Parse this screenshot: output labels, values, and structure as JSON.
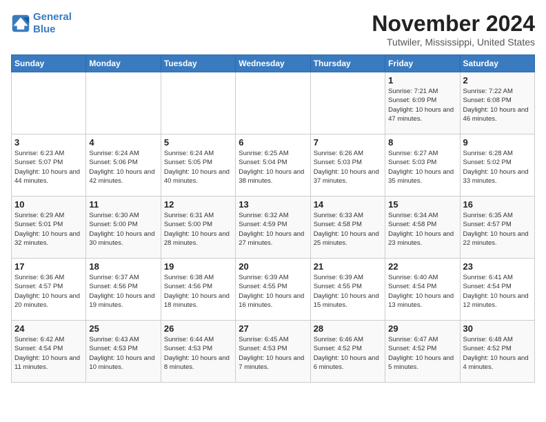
{
  "logo": {
    "line1": "General",
    "line2": "Blue"
  },
  "title": "November 2024",
  "location": "Tutwiler, Mississippi, United States",
  "days_of_week": [
    "Sunday",
    "Monday",
    "Tuesday",
    "Wednesday",
    "Thursday",
    "Friday",
    "Saturday"
  ],
  "weeks": [
    [
      {
        "day": "",
        "info": ""
      },
      {
        "day": "",
        "info": ""
      },
      {
        "day": "",
        "info": ""
      },
      {
        "day": "",
        "info": ""
      },
      {
        "day": "",
        "info": ""
      },
      {
        "day": "1",
        "info": "Sunrise: 7:21 AM\nSunset: 6:09 PM\nDaylight: 10 hours and 47 minutes."
      },
      {
        "day": "2",
        "info": "Sunrise: 7:22 AM\nSunset: 6:08 PM\nDaylight: 10 hours and 46 minutes."
      }
    ],
    [
      {
        "day": "3",
        "info": "Sunrise: 6:23 AM\nSunset: 5:07 PM\nDaylight: 10 hours and 44 minutes."
      },
      {
        "day": "4",
        "info": "Sunrise: 6:24 AM\nSunset: 5:06 PM\nDaylight: 10 hours and 42 minutes."
      },
      {
        "day": "5",
        "info": "Sunrise: 6:24 AM\nSunset: 5:05 PM\nDaylight: 10 hours and 40 minutes."
      },
      {
        "day": "6",
        "info": "Sunrise: 6:25 AM\nSunset: 5:04 PM\nDaylight: 10 hours and 38 minutes."
      },
      {
        "day": "7",
        "info": "Sunrise: 6:26 AM\nSunset: 5:03 PM\nDaylight: 10 hours and 37 minutes."
      },
      {
        "day": "8",
        "info": "Sunrise: 6:27 AM\nSunset: 5:03 PM\nDaylight: 10 hours and 35 minutes."
      },
      {
        "day": "9",
        "info": "Sunrise: 6:28 AM\nSunset: 5:02 PM\nDaylight: 10 hours and 33 minutes."
      }
    ],
    [
      {
        "day": "10",
        "info": "Sunrise: 6:29 AM\nSunset: 5:01 PM\nDaylight: 10 hours and 32 minutes."
      },
      {
        "day": "11",
        "info": "Sunrise: 6:30 AM\nSunset: 5:00 PM\nDaylight: 10 hours and 30 minutes."
      },
      {
        "day": "12",
        "info": "Sunrise: 6:31 AM\nSunset: 5:00 PM\nDaylight: 10 hours and 28 minutes."
      },
      {
        "day": "13",
        "info": "Sunrise: 6:32 AM\nSunset: 4:59 PM\nDaylight: 10 hours and 27 minutes."
      },
      {
        "day": "14",
        "info": "Sunrise: 6:33 AM\nSunset: 4:58 PM\nDaylight: 10 hours and 25 minutes."
      },
      {
        "day": "15",
        "info": "Sunrise: 6:34 AM\nSunset: 4:58 PM\nDaylight: 10 hours and 23 minutes."
      },
      {
        "day": "16",
        "info": "Sunrise: 6:35 AM\nSunset: 4:57 PM\nDaylight: 10 hours and 22 minutes."
      }
    ],
    [
      {
        "day": "17",
        "info": "Sunrise: 6:36 AM\nSunset: 4:57 PM\nDaylight: 10 hours and 20 minutes."
      },
      {
        "day": "18",
        "info": "Sunrise: 6:37 AM\nSunset: 4:56 PM\nDaylight: 10 hours and 19 minutes."
      },
      {
        "day": "19",
        "info": "Sunrise: 6:38 AM\nSunset: 4:56 PM\nDaylight: 10 hours and 18 minutes."
      },
      {
        "day": "20",
        "info": "Sunrise: 6:39 AM\nSunset: 4:55 PM\nDaylight: 10 hours and 16 minutes."
      },
      {
        "day": "21",
        "info": "Sunrise: 6:39 AM\nSunset: 4:55 PM\nDaylight: 10 hours and 15 minutes."
      },
      {
        "day": "22",
        "info": "Sunrise: 6:40 AM\nSunset: 4:54 PM\nDaylight: 10 hours and 13 minutes."
      },
      {
        "day": "23",
        "info": "Sunrise: 6:41 AM\nSunset: 4:54 PM\nDaylight: 10 hours and 12 minutes."
      }
    ],
    [
      {
        "day": "24",
        "info": "Sunrise: 6:42 AM\nSunset: 4:54 PM\nDaylight: 10 hours and 11 minutes."
      },
      {
        "day": "25",
        "info": "Sunrise: 6:43 AM\nSunset: 4:53 PM\nDaylight: 10 hours and 10 minutes."
      },
      {
        "day": "26",
        "info": "Sunrise: 6:44 AM\nSunset: 4:53 PM\nDaylight: 10 hours and 8 minutes."
      },
      {
        "day": "27",
        "info": "Sunrise: 6:45 AM\nSunset: 4:53 PM\nDaylight: 10 hours and 7 minutes."
      },
      {
        "day": "28",
        "info": "Sunrise: 6:46 AM\nSunset: 4:52 PM\nDaylight: 10 hours and 6 minutes."
      },
      {
        "day": "29",
        "info": "Sunrise: 6:47 AM\nSunset: 4:52 PM\nDaylight: 10 hours and 5 minutes."
      },
      {
        "day": "30",
        "info": "Sunrise: 6:48 AM\nSunset: 4:52 PM\nDaylight: 10 hours and 4 minutes."
      }
    ]
  ]
}
